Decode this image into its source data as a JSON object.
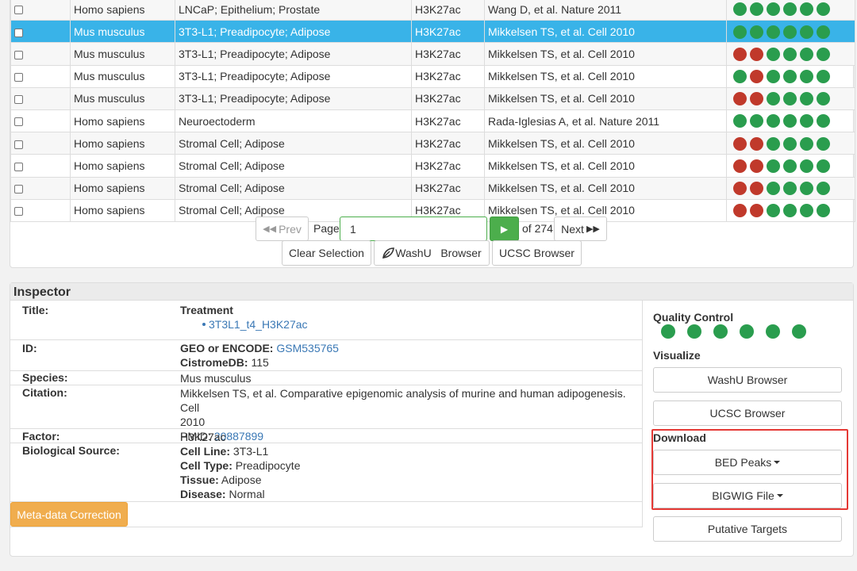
{
  "results": {
    "rows": [
      {
        "species": "Homo sapiens",
        "bio": "LNCaP; Epithelium; Prostate",
        "factor": "H3K27ac",
        "pub": "Wang D, et al. Nature 2011",
        "qc": [
          "green",
          "green",
          "green",
          "green",
          "green",
          "green"
        ],
        "selected": false
      },
      {
        "species": "Mus musculus",
        "bio": "3T3-L1; Preadipocyte; Adipose",
        "factor": "H3K27ac",
        "pub": "Mikkelsen TS, et al. Cell 2010",
        "qc": [
          "green",
          "green",
          "green",
          "green",
          "green",
          "green"
        ],
        "selected": true
      },
      {
        "species": "Mus musculus",
        "bio": "3T3-L1; Preadipocyte; Adipose",
        "factor": "H3K27ac",
        "pub": "Mikkelsen TS, et al. Cell 2010",
        "qc": [
          "red",
          "red",
          "green",
          "green",
          "green",
          "green"
        ],
        "selected": false
      },
      {
        "species": "Mus musculus",
        "bio": "3T3-L1; Preadipocyte; Adipose",
        "factor": "H3K27ac",
        "pub": "Mikkelsen TS, et al. Cell 2010",
        "qc": [
          "green",
          "red",
          "green",
          "green",
          "green",
          "green"
        ],
        "selected": false
      },
      {
        "species": "Mus musculus",
        "bio": "3T3-L1; Preadipocyte; Adipose",
        "factor": "H3K27ac",
        "pub": "Mikkelsen TS, et al. Cell 2010",
        "qc": [
          "red",
          "red",
          "green",
          "green",
          "green",
          "green"
        ],
        "selected": false
      },
      {
        "species": "Homo sapiens",
        "bio": "Neuroectoderm",
        "factor": "H3K27ac",
        "pub": "Rada-Iglesias A, et al. Nature 2011",
        "qc": [
          "green",
          "green",
          "green",
          "green",
          "green",
          "green"
        ],
        "selected": false
      },
      {
        "species": "Homo sapiens",
        "bio": "Stromal Cell; Adipose",
        "factor": "H3K27ac",
        "pub": "Mikkelsen TS, et al. Cell 2010",
        "qc": [
          "red",
          "red",
          "green",
          "green",
          "green",
          "green"
        ],
        "selected": false
      },
      {
        "species": "Homo sapiens",
        "bio": "Stromal Cell; Adipose",
        "factor": "H3K27ac",
        "pub": "Mikkelsen TS, et al. Cell 2010",
        "qc": [
          "red",
          "red",
          "green",
          "green",
          "green",
          "green"
        ],
        "selected": false
      },
      {
        "species": "Homo sapiens",
        "bio": "Stromal Cell; Adipose",
        "factor": "H3K27ac",
        "pub": "Mikkelsen TS, et al. Cell 2010",
        "qc": [
          "red",
          "red",
          "green",
          "green",
          "green",
          "green"
        ],
        "selected": false
      },
      {
        "species": "Homo sapiens",
        "bio": "Stromal Cell; Adipose",
        "factor": "H3K27ac",
        "pub": "Mikkelsen TS, et al. Cell 2010",
        "qc": [
          "red",
          "red",
          "green",
          "green",
          "green",
          "green"
        ],
        "selected": false
      }
    ]
  },
  "pager": {
    "prev_label": "Prev",
    "page_label": "Page",
    "page_value": "1",
    "of_label": "of 274",
    "next_label": "Next",
    "clear_label": "Clear Selection",
    "washu_label": "WashU   Browser",
    "ucsc_label": "UCSC Browser"
  },
  "inspector": {
    "header": "Inspector",
    "title_key": "Title:",
    "treatment_label": "Treatment",
    "treatment_item": "3T3L1_t4_H3K27ac",
    "id_key": "ID:",
    "geo_label": "GEO or ENCODE:",
    "geo_value": "GSM535765",
    "cistrome_label": "CistromeDB:",
    "cistrome_value": "115",
    "species_key": "Species:",
    "species_value": "Mus musculus",
    "citation_key": "Citation:",
    "citation_line1": "Mikkelsen TS, et al. Comparative epigenomic analysis of murine and human adipogenesis. Cell",
    "citation_line2": "2010",
    "pmid_label": "PMID:",
    "pmid_value": "20887899",
    "factor_key": "Factor:",
    "factor_value": "H3K27ac",
    "bio_key": "Biological Source:",
    "cell_line_label": "Cell Line:",
    "cell_line_value": "3T3-L1",
    "cell_type_label": "Cell Type:",
    "cell_type_value": "Preadipocyte",
    "tissue_label": "Tissue:",
    "tissue_value": "Adipose",
    "disease_label": "Disease:",
    "disease_value": "Normal",
    "meta_button": "Meta-data Correction"
  },
  "side": {
    "qc_title": "Quality Control",
    "qc": [
      "green",
      "green",
      "green",
      "green",
      "green",
      "green"
    ],
    "visualize_title": "Visualize",
    "washu_button": "WashU Browser",
    "ucsc_button": "UCSC Browser",
    "download_title": "Download",
    "bed_button": "BED Peaks",
    "bigwig_button": "BIGWIG File",
    "putative_button": "Putative Targets"
  },
  "colors": {
    "selected_row": "#39b3e8",
    "qc_green": "#2a9d4e",
    "qc_red": "#c0392b",
    "go_button": "#4cae4c",
    "meta_button": "#f0ad4e",
    "highlight": "#e53935"
  }
}
